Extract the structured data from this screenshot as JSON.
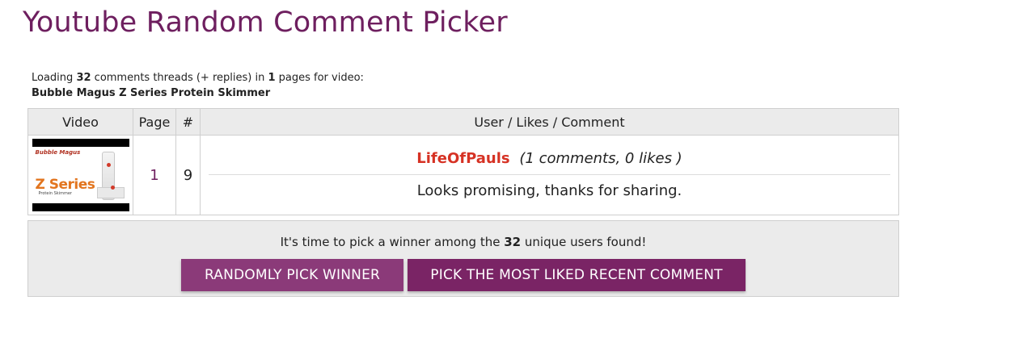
{
  "page": {
    "title": "Youtube Random Comment Picker"
  },
  "loading": {
    "prefix": "Loading",
    "count": "32",
    "middle": "comments threads (+ replies) in",
    "pages": "1",
    "suffix": "pages for video:",
    "video_title": "Bubble Magus Z Series Protein Skimmer"
  },
  "table": {
    "headers": {
      "video": "Video",
      "page": "Page",
      "index": "#",
      "comment": "User / Likes / Comment"
    },
    "row": {
      "thumbnail": {
        "logo_text": "Bubble Magus",
        "title_text": "Z Series",
        "sub_text": "Protein Skimmer"
      },
      "page": "1",
      "index": "9",
      "user": "LifeOfPauls",
      "stats": "(1 comments, 0 likes )",
      "comment": "Looks promising, thanks for sharing."
    }
  },
  "pick": {
    "msg_prefix": "It's time to pick a winner among the",
    "count": "32",
    "msg_suffix": "unique users found!",
    "random_label": "RANDOMLY PICK WINNER",
    "liked_label": "PICK THE MOST LIKED RECENT COMMENT"
  },
  "colors": {
    "brand": "#6e1f5f",
    "user": "#d63224",
    "button_random": "#8b3a79",
    "button_liked": "#7a2465"
  }
}
